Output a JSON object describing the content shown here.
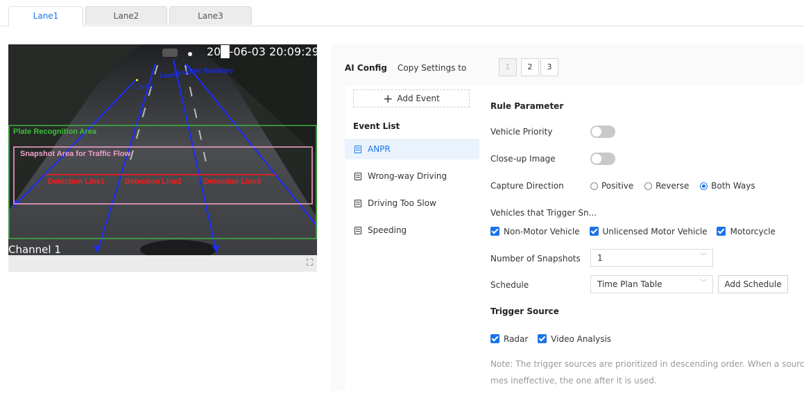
{
  "tabs": [
    {
      "label": "Lane1",
      "active": true
    },
    {
      "label": "Lane2",
      "active": false
    },
    {
      "label": "Lane3",
      "active": false
    }
  ],
  "video": {
    "timestamp": "20█-06-03 20:09:29",
    "channel": "Channel 1",
    "overlays": {
      "plate_area": "Plate Recognition Area",
      "snapshot_area": "Snapshot Area for Traffic Flow",
      "detection_lines": [
        "Detection Line1",
        "Detection Line2",
        "Detection Line3"
      ],
      "lane_labels": [
        "Lane1",
        "Lane2",
        "Lane3",
        "Lane Boundary"
      ]
    },
    "colors": {
      "plate": "#3cbf3c",
      "snapshot": "#f0a0c8",
      "detection": "#ff1a1a",
      "lane": "#1a2cff"
    }
  },
  "config": {
    "title": "AI Config",
    "copy_label": "Copy Settings to",
    "copy_buttons": [
      "1",
      "2",
      "3"
    ]
  },
  "sidebar": {
    "add_event": "Add Event",
    "event_list_title": "Event List",
    "events": [
      {
        "label": "ANPR",
        "active": true
      },
      {
        "label": "Wrong-way Driving",
        "active": false
      },
      {
        "label": "Driving Too Slow",
        "active": false
      },
      {
        "label": "Speeding",
        "active": false
      }
    ]
  },
  "rule": {
    "title": "Rule Parameter",
    "vehicle_priority_label": "Vehicle Priority",
    "vehicle_priority_on": false,
    "closeup_label": "Close-up Image",
    "closeup_on": false,
    "capture_direction_label": "Capture Direction",
    "capture_options": [
      "Positive",
      "Reverse",
      "Both Ways"
    ],
    "capture_selected": "Both Ways",
    "vehicles_label": "Vehicles that Trigger Sn...",
    "vehicles": [
      "Non-Motor Vehicle",
      "Unlicensed Motor Vehicle",
      "Motorcycle"
    ],
    "snapshots_label": "Number of Snapshots",
    "snapshots_value": "1",
    "schedule_label": "Schedule",
    "schedule_value": "Time Plan Table",
    "add_schedule": "Add Schedule"
  },
  "trigger": {
    "title": "Trigger Source",
    "sources": [
      "Radar",
      "Video Analysis"
    ],
    "note_line1": "Note: The trigger sources are prioritized in descending order. When a source beco",
    "note_line2": "mes ineffective, the one after it is used."
  },
  "theme": {
    "accent": "#1a73e8"
  }
}
